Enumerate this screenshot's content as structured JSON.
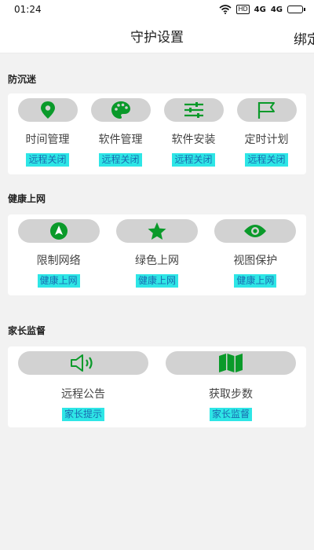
{
  "status_bar": {
    "time": "01:24",
    "hd": "HD",
    "sig1": "4G",
    "sig2": "4G"
  },
  "nav": {
    "title": "守护设置",
    "right": "绑定"
  },
  "sections": [
    {
      "title": "防沉迷",
      "items": [
        {
          "label": "时间管理",
          "tag": "远程关闭",
          "icon": "location-pin-icon"
        },
        {
          "label": "软件管理",
          "tag": "远程关闭",
          "icon": "palette-icon"
        },
        {
          "label": "软件安装",
          "tag": "远程关闭",
          "icon": "sliders-icon"
        },
        {
          "label": "定时计划",
          "tag": "远程关闭",
          "icon": "flag-icon"
        }
      ]
    },
    {
      "title": "健康上网",
      "items": [
        {
          "label": "限制网络",
          "tag": "健康上网",
          "icon": "navigation-arrow-icon"
        },
        {
          "label": "绿色上网",
          "tag": "健康上网",
          "icon": "star-icon"
        },
        {
          "label": "视图保护",
          "tag": "健康上网",
          "icon": "eye-icon"
        }
      ]
    },
    {
      "title": "家长监督",
      "items": [
        {
          "label": "远程公告",
          "tag": "家长提示",
          "icon": "speaker-icon"
        },
        {
          "label": "获取步数",
          "tag": "家长监督",
          "icon": "map-icon"
        }
      ]
    }
  ],
  "colors": {
    "accent_green": "#0a9a2a",
    "tag_bg": "#2ee6e6",
    "tag_text": "#1a6bb0",
    "pill_bg": "#d2d2d2"
  }
}
